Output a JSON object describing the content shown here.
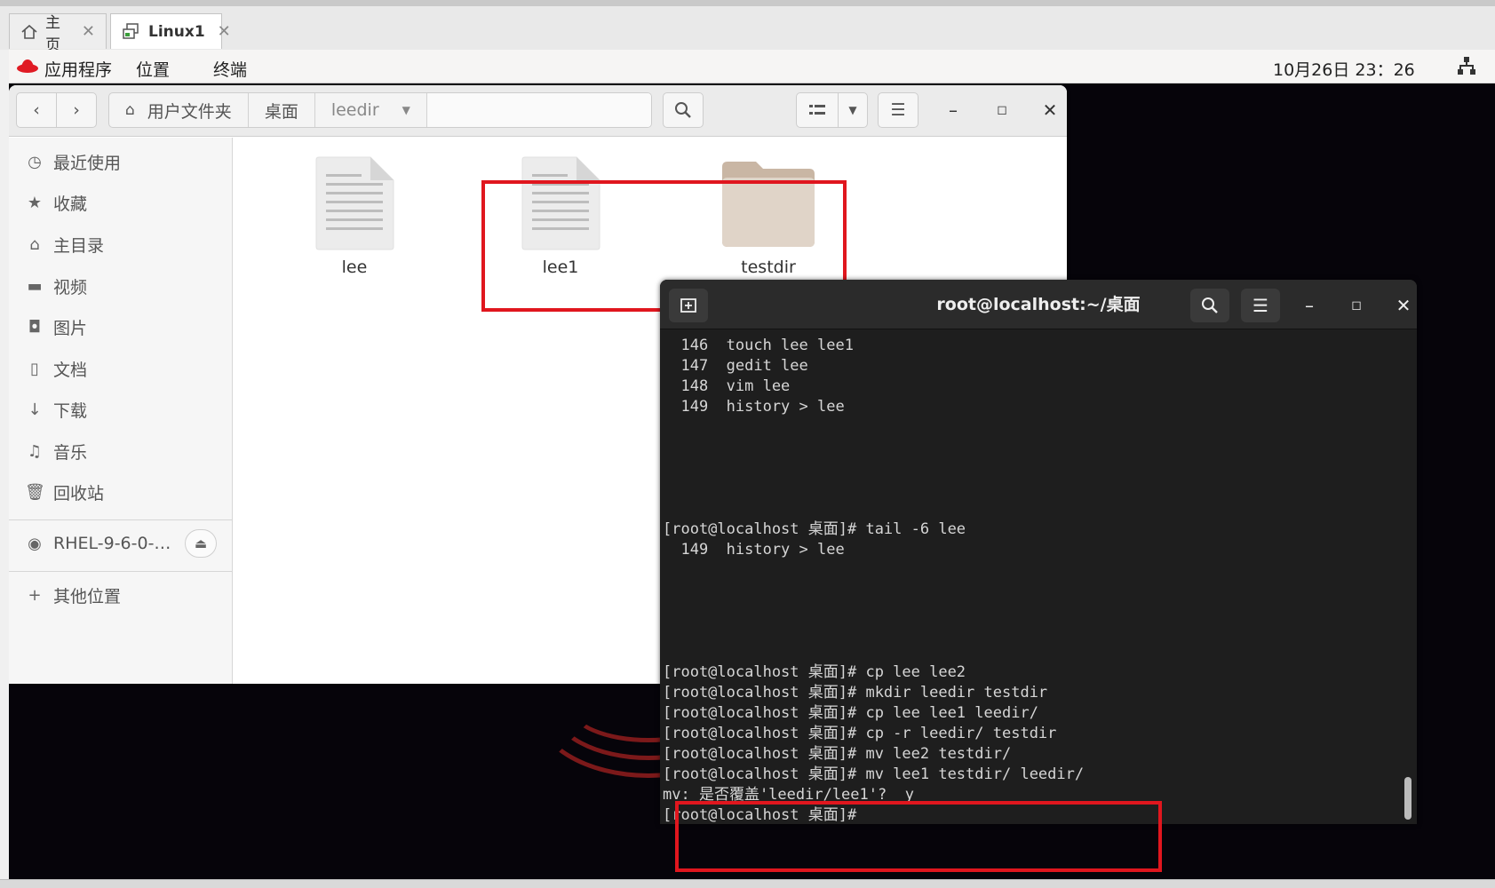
{
  "vm_tabs": [
    {
      "label": "主页",
      "icon": "home-icon"
    },
    {
      "label": "Linux1",
      "icon": "vm-icon"
    }
  ],
  "topbar": {
    "applications": "应用程序",
    "places": "位置",
    "terminal": "终端",
    "datetime": "10月26日  23：26"
  },
  "files": {
    "path": [
      "用户文件夹",
      "桌面",
      "leedir"
    ],
    "sidebar": [
      {
        "label": "最近使用",
        "icon": "clock-icon"
      },
      {
        "label": "收藏",
        "icon": "star-icon"
      },
      {
        "label": "主目录",
        "icon": "home-icon"
      },
      {
        "label": "视频",
        "icon": "video-icon"
      },
      {
        "label": "图片",
        "icon": "camera-icon"
      },
      {
        "label": "文档",
        "icon": "document-icon"
      },
      {
        "label": "下载",
        "icon": "download-icon"
      },
      {
        "label": "音乐",
        "icon": "music-icon"
      },
      {
        "label": "回收站",
        "icon": "trash-icon"
      }
    ],
    "device": "RHEL-9-6-0-…",
    "other_places": "其他位置",
    "items": [
      {
        "name": "lee",
        "type": "text-file"
      },
      {
        "name": "lee1",
        "type": "text-file"
      },
      {
        "name": "testdir",
        "type": "folder"
      }
    ]
  },
  "terminal": {
    "title": "root@localhost:~/桌面",
    "lines": [
      "  146  touch lee lee1",
      "  147  gedit lee",
      "  148  vim lee",
      "  149  history > lee",
      "",
      "",
      "",
      "",
      "",
      "[root@localhost 桌面]# tail -6 lee",
      "  149  history > lee",
      "",
      "",
      "",
      "",
      "",
      "[root@localhost 桌面]# cp lee lee2",
      "[root@localhost 桌面]# mkdir leedir testdir",
      "[root@localhost 桌面]# cp lee lee1 leedir/",
      "[root@localhost 桌面]# cp -r leedir/ testdir",
      "[root@localhost 桌面]# mv lee2 testdir/",
      "[root@localhost 桌面]# mv lee1 testdir/ leedir/",
      "mv: 是否覆盖'leedir/lee1'?  y",
      "[root@localhost 桌面]# "
    ]
  },
  "colors": {
    "highlight": "#e0161e",
    "terminal_bg": "#1e1e1e"
  }
}
